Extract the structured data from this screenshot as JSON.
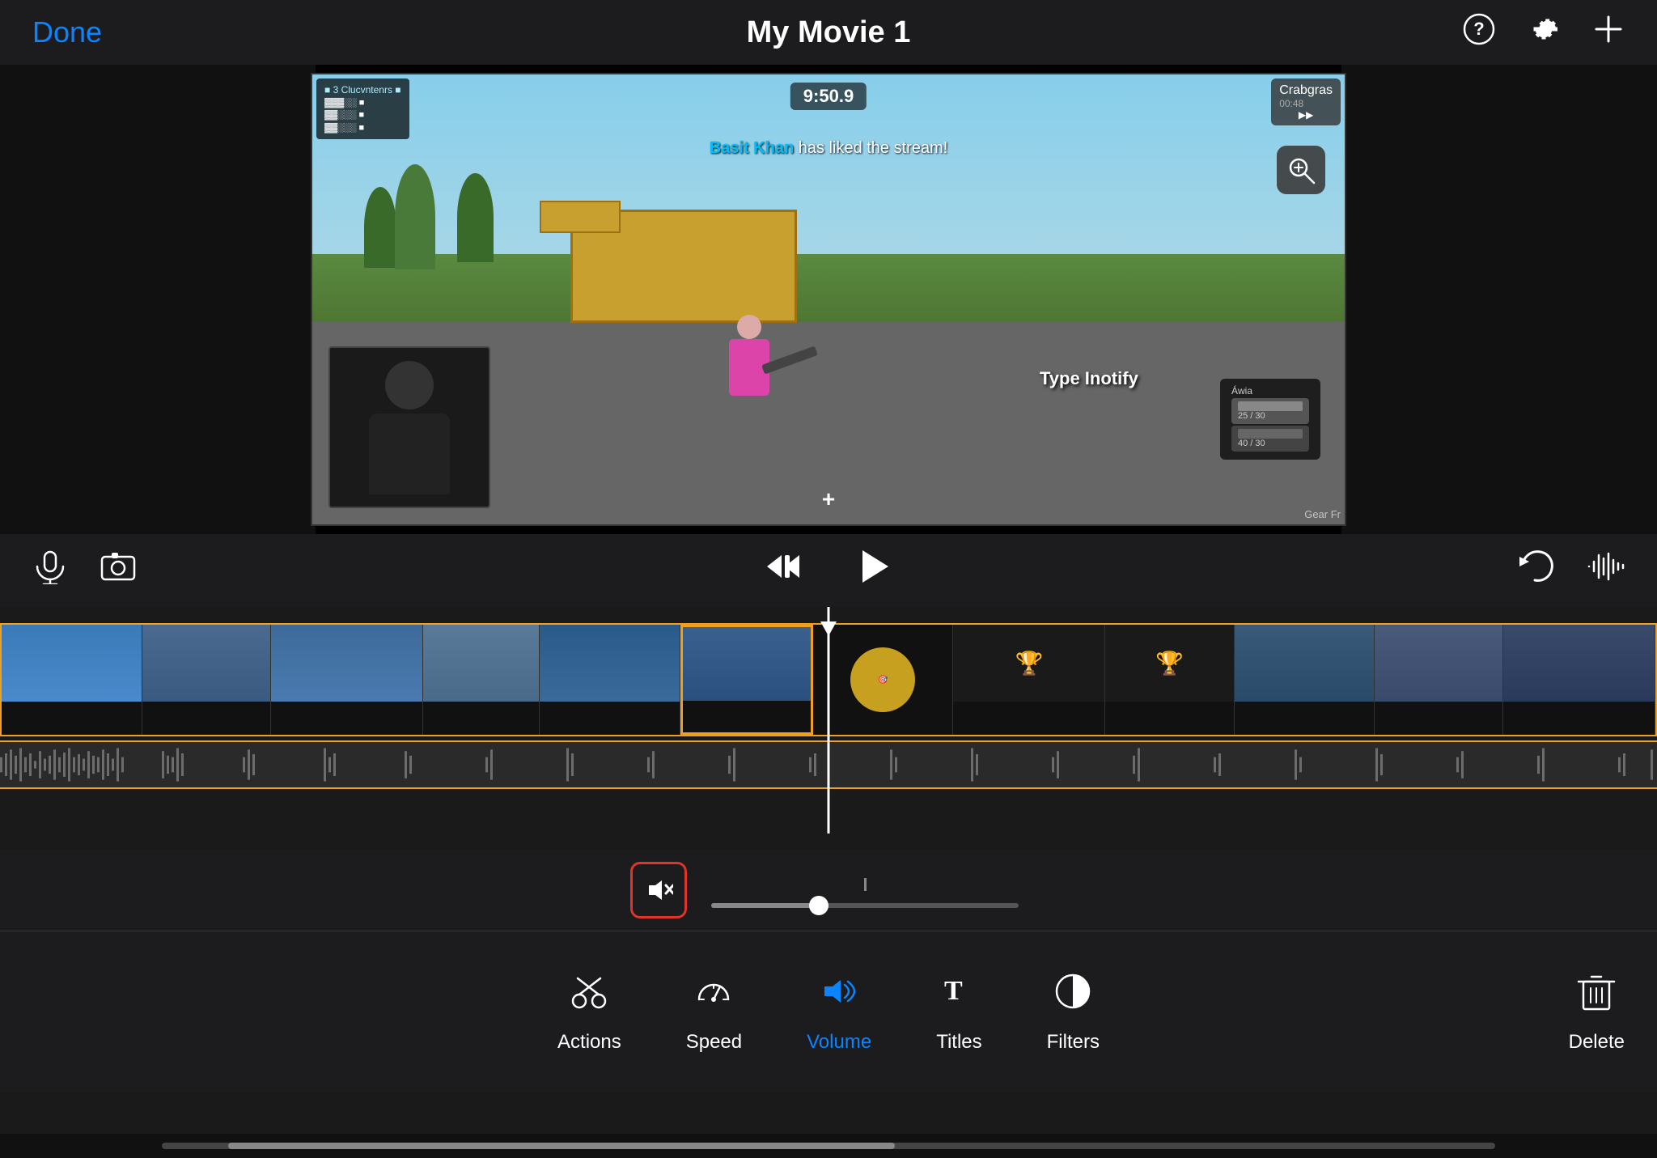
{
  "header": {
    "done_label": "Done",
    "title": "My Movie 1",
    "help_icon": "?",
    "settings_icon": "⚙",
    "add_icon": "+"
  },
  "preview": {
    "game_timer": "9:50.9",
    "notification_text": "has liked the stream!",
    "notification_name": "Basit Khan",
    "building_label": "Crabgras",
    "type_label": "Type Inotify",
    "watermark": "Gear Fr"
  },
  "transport": {
    "mic_icon": "mic",
    "camera_icon": "camera",
    "skip_back_icon": "skip-back",
    "play_icon": "play",
    "undo_icon": "undo",
    "waveform_icon": "waveform"
  },
  "volume": {
    "icon": "speaker-mute",
    "slider_value": 35
  },
  "toolbar": {
    "items": [
      {
        "id": "actions",
        "label": "Actions",
        "icon": "scissors"
      },
      {
        "id": "speed",
        "label": "Speed",
        "icon": "speedometer"
      },
      {
        "id": "volume",
        "label": "Volume",
        "icon": "speaker",
        "active": true
      },
      {
        "id": "titles",
        "label": "Titles",
        "icon": "text"
      },
      {
        "id": "filters",
        "label": "Filters",
        "icon": "circle-half"
      }
    ],
    "delete_label": "Delete"
  },
  "timeline": {
    "clips": [
      {
        "id": 1,
        "color": "clip-1"
      },
      {
        "id": 2,
        "color": "clip-2"
      },
      {
        "id": 3,
        "color": "clip-3"
      },
      {
        "id": 4,
        "color": "clip-4"
      },
      {
        "id": 5,
        "color": "clip-5"
      },
      {
        "id": 6,
        "color": "clip-6"
      },
      {
        "id": 7,
        "color": "clip-7"
      },
      {
        "id": 8,
        "color": "clip-8"
      },
      {
        "id": 9,
        "color": "clip-9"
      },
      {
        "id": 10,
        "color": "clip-10"
      },
      {
        "id": 11,
        "color": "clip-11"
      },
      {
        "id": 12,
        "color": "clip-12"
      }
    ]
  }
}
